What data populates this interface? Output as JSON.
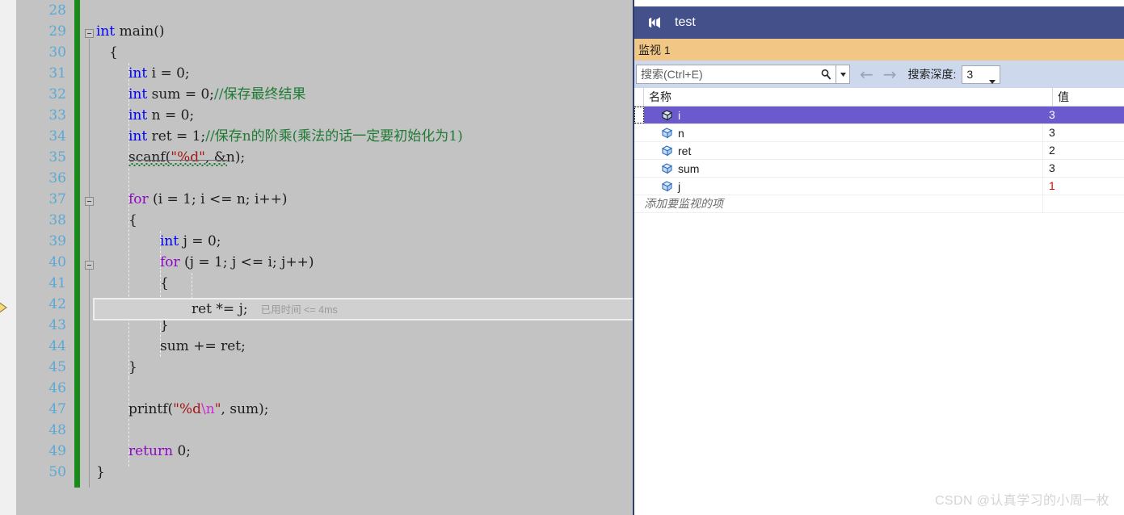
{
  "editor": {
    "first_line_number": 28,
    "line_numbers": [
      28,
      29,
      30,
      31,
      32,
      33,
      34,
      35,
      36,
      37,
      38,
      39,
      40,
      41,
      42,
      43,
      44,
      45,
      46,
      47,
      48,
      49,
      50
    ],
    "current_execution_line": 42,
    "highlighted_line_number": 42,
    "perf_tip": "已用时间 <= 4ms",
    "lines": [
      {
        "n": 28,
        "text": ""
      },
      {
        "n": 29,
        "text": "int main()"
      },
      {
        "n": 30,
        "text": "{"
      },
      {
        "n": 31,
        "text": "    int i = 0;"
      },
      {
        "n": 32,
        "text": "    int sum = 0;//保存最终结果"
      },
      {
        "n": 33,
        "text": "    int n = 0;"
      },
      {
        "n": 34,
        "text": "    int ret = 1;//保存n的阶乘(乘法的话一定要初始化为1)"
      },
      {
        "n": 35,
        "text": "    scanf(\"%d\", &n);"
      },
      {
        "n": 36,
        "text": ""
      },
      {
        "n": 37,
        "text": "    for (i = 1; i <= n; i++)"
      },
      {
        "n": 38,
        "text": "    {"
      },
      {
        "n": 39,
        "text": "        int j = 0;"
      },
      {
        "n": 40,
        "text": "        for (j = 1; j <= i; j++)"
      },
      {
        "n": 41,
        "text": "        {"
      },
      {
        "n": 42,
        "text": "            ret *= j;"
      },
      {
        "n": 43,
        "text": "        }"
      },
      {
        "n": 44,
        "text": "        sum += ret;"
      },
      {
        "n": 45,
        "text": "    }"
      },
      {
        "n": 46,
        "text": ""
      },
      {
        "n": 47,
        "text": "    printf(\"%d\\n\", sum);"
      },
      {
        "n": 48,
        "text": ""
      },
      {
        "n": 49,
        "text": "    return 0;"
      },
      {
        "n": 50,
        "text": "}"
      }
    ],
    "tokens": {
      "kw_int": "int",
      "kw_for": "for",
      "kw_return": "return",
      "fn_main": " main()",
      "brace_open": "{",
      "brace_close": "}",
      "decl_i": "    ",
      "comment_sum": "//保存最终结果",
      "comment_ret": "//保存n的阶乘(乘法的话一定要初始化为1)",
      "str_d": "\"%d\"",
      "str_dn_open": "\"%d",
      "str_dn_esc": "\\n",
      "str_dn_close": "\""
    }
  },
  "watch_window": {
    "title": "test",
    "logo_icon": "visual-studio-logo-icon",
    "tab_label": "监视 1",
    "toolbar": {
      "search_placeholder": "搜索(Ctrl+E)",
      "search_value": "",
      "search_icon": "search-icon",
      "dropdown_icon": "chevron-down-icon",
      "back_icon": "arrow-left-icon",
      "forward_icon": "arrow-right-icon",
      "depth_label": "搜索深度:",
      "depth_value": "3",
      "depth_caret_icon": "chevron-down-icon"
    },
    "columns": [
      "名称",
      "值"
    ],
    "rows": [
      {
        "name": "i",
        "value": "3",
        "icon": "variable-icon",
        "selected": true,
        "changed": false
      },
      {
        "name": "n",
        "value": "3",
        "icon": "variable-icon",
        "selected": false,
        "changed": false
      },
      {
        "name": "ret",
        "value": "2",
        "icon": "variable-icon",
        "selected": false,
        "changed": false
      },
      {
        "name": "sum",
        "value": "3",
        "icon": "variable-icon",
        "selected": false,
        "changed": false
      },
      {
        "name": "j",
        "value": "1",
        "icon": "variable-icon",
        "selected": false,
        "changed": true
      }
    ],
    "add_watch_placeholder": "添加要监视的项"
  },
  "watermark": "CSDN @认真学习的小周一枚",
  "colors": {
    "editor_bg": "#c3c3c3",
    "changebar_green": "#1a8a18",
    "lineno_blue": "#5ca9d4",
    "titlebar_blue": "#44508a",
    "tabbar_orange": "#f2c786",
    "toolbar_blue": "#cdd8ed",
    "selection_purple": "#6a5acd",
    "changed_value_red": "#dd0000",
    "keyword_blue": "#0000ff",
    "control_purple": "#8f08c4",
    "comment_green": "#1f7a33",
    "string_red": "#a31515",
    "exec_arrow_yellow": "#f5d87a"
  }
}
